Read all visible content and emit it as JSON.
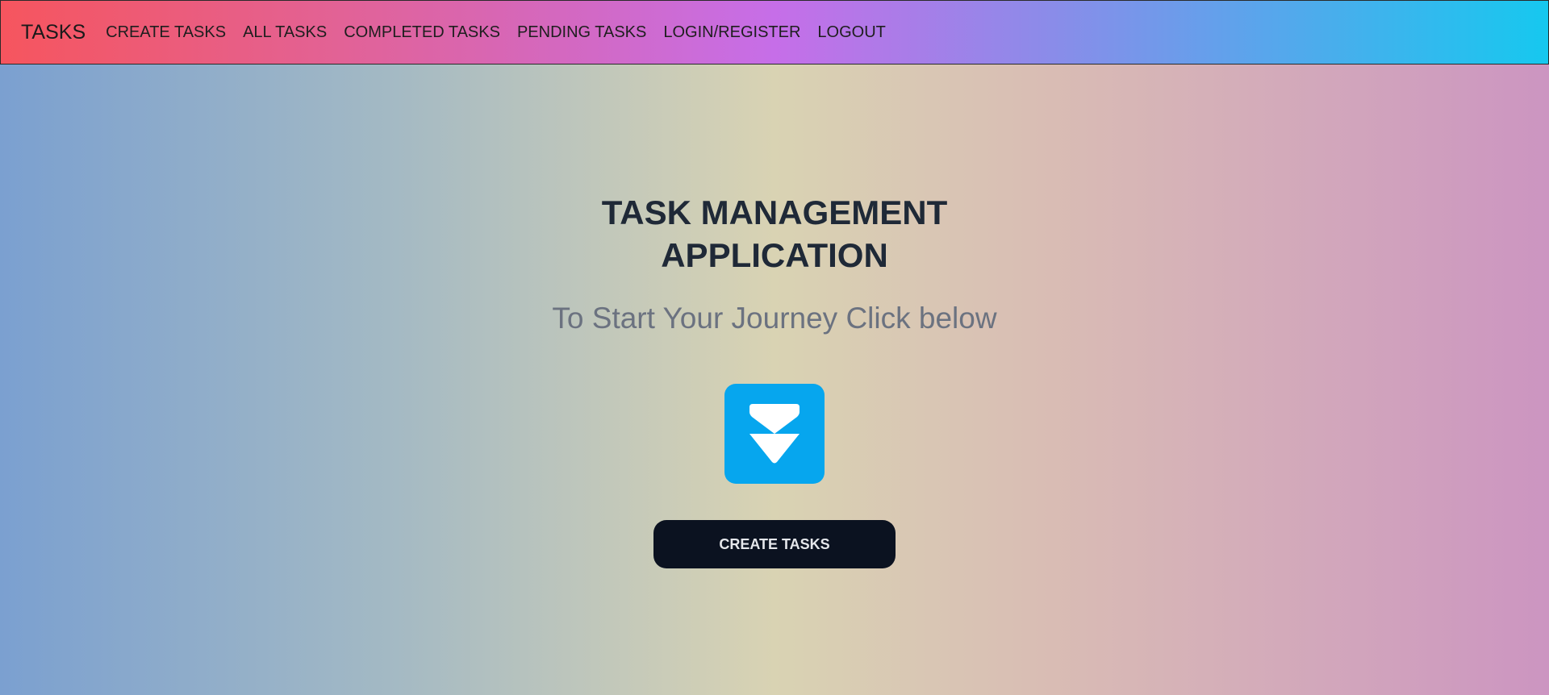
{
  "navbar": {
    "brand": "TASKS",
    "items": [
      {
        "label": "CREATE TASKS"
      },
      {
        "label": "ALL TASKS"
      },
      {
        "label": "COMPLETED TASKS"
      },
      {
        "label": "PENDING TASKS"
      },
      {
        "label": "LOGIN/REGISTER"
      },
      {
        "label": "LOGOUT"
      }
    ]
  },
  "hero": {
    "title_line1": "TASK MANAGEMENT",
    "title_line2": "APPLICATION",
    "subtitle": "To Start Your Journey Click below",
    "icon": "double-chevron-down-icon",
    "icon_color": "#06a6ee",
    "button_label": "CREATE TASKS"
  }
}
